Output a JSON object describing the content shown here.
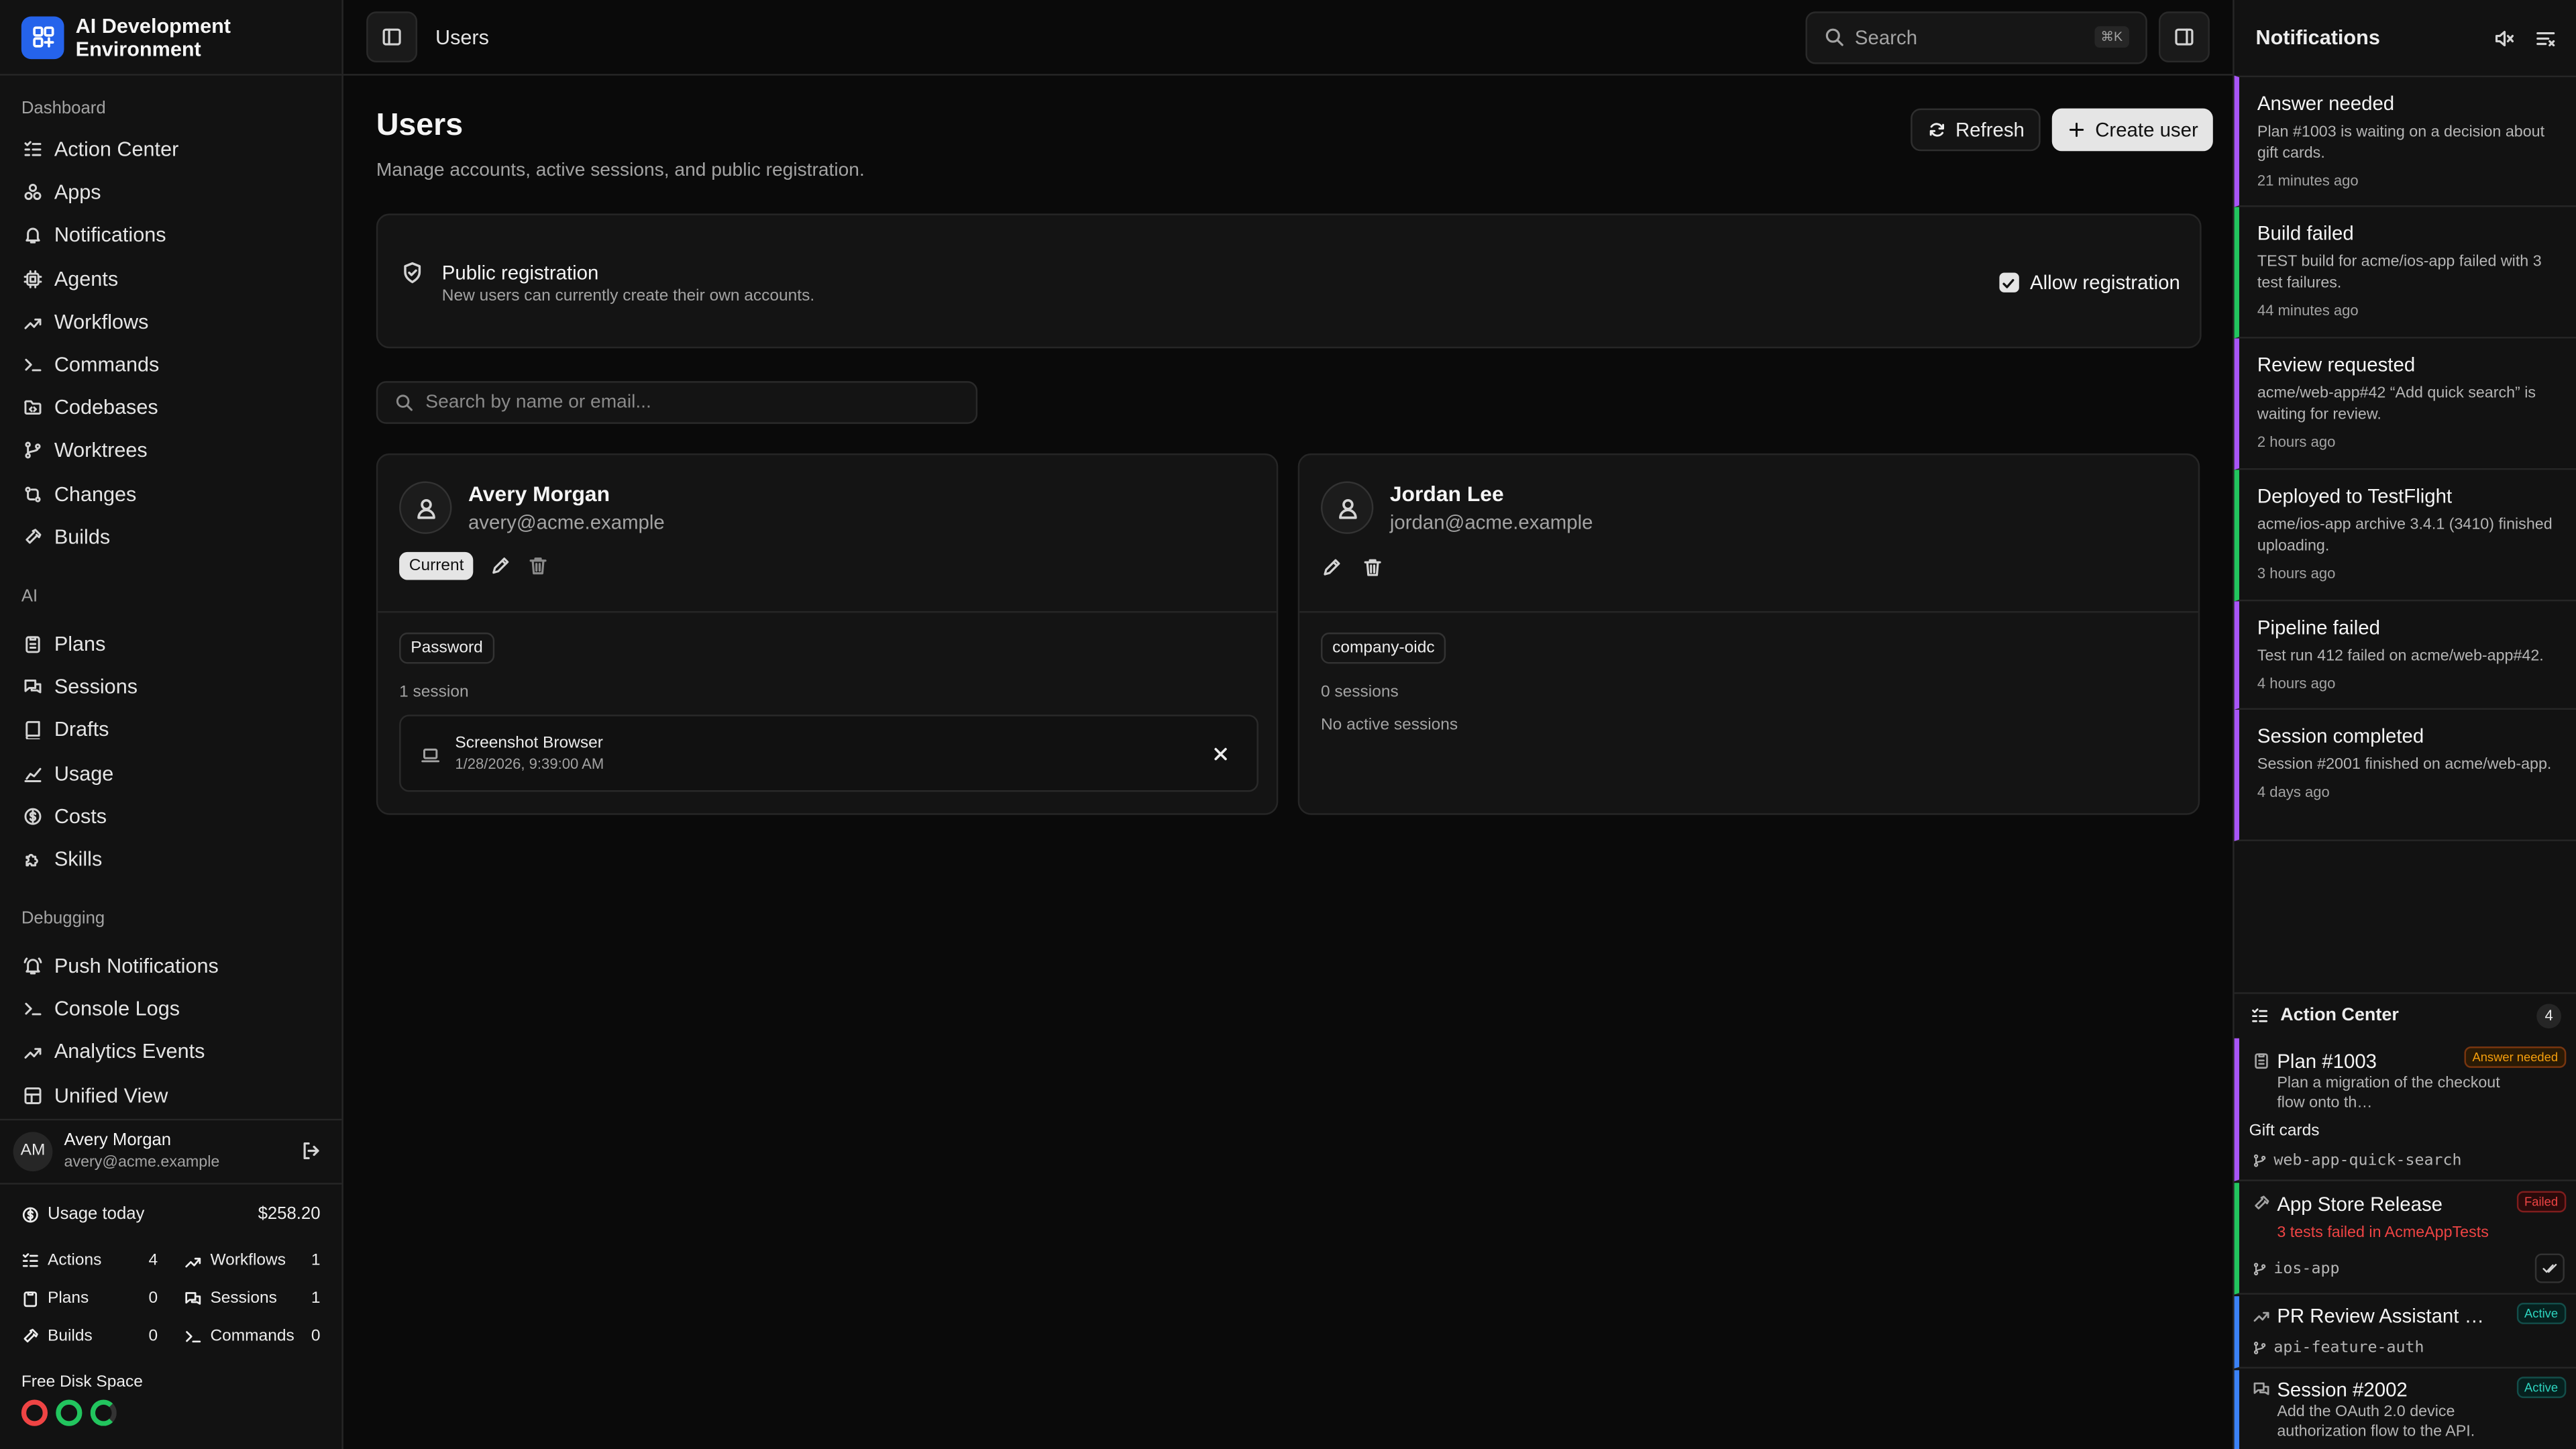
{
  "app": {
    "title": "AI Development Environment"
  },
  "sidebar": {
    "sections": {
      "dashboard": "Dashboard",
      "ai": "AI",
      "debugging": "Debugging"
    },
    "dashboard_items": [
      {
        "label": "Action Center",
        "icon": "list-check-icon"
      },
      {
        "label": "Apps",
        "icon": "apps-icon"
      },
      {
        "label": "Notifications",
        "icon": "bell-icon"
      },
      {
        "label": "Agents",
        "icon": "cpu-icon"
      },
      {
        "label": "Workflows",
        "icon": "workflow-icon"
      },
      {
        "label": "Commands",
        "icon": "terminal-icon"
      },
      {
        "label": "Codebases",
        "icon": "folder-code-icon"
      },
      {
        "label": "Worktrees",
        "icon": "git-branch-icon"
      },
      {
        "label": "Changes",
        "icon": "git-compare-icon"
      },
      {
        "label": "Builds",
        "icon": "hammer-icon"
      }
    ],
    "ai_items": [
      {
        "label": "Plans",
        "icon": "clipboard-icon"
      },
      {
        "label": "Sessions",
        "icon": "messages-icon"
      },
      {
        "label": "Drafts",
        "icon": "book-icon"
      },
      {
        "label": "Usage",
        "icon": "chart-icon"
      },
      {
        "label": "Costs",
        "icon": "dollar-icon"
      },
      {
        "label": "Skills",
        "icon": "puzzle-icon"
      }
    ],
    "debugging_items": [
      {
        "label": "Push Notifications",
        "icon": "bell-ring-icon"
      },
      {
        "label": "Console Logs",
        "icon": "terminal-icon"
      },
      {
        "label": "Analytics Events",
        "icon": "workflow-icon"
      },
      {
        "label": "Unified View",
        "icon": "layout-icon"
      }
    ],
    "user": {
      "initials": "AM",
      "name": "Avery Morgan",
      "email": "avery@acme.example"
    },
    "usage": {
      "label": "Usage today",
      "value": "$258.20",
      "stats": [
        {
          "label": "Actions",
          "value": "4"
        },
        {
          "label": "Workflows",
          "value": "1"
        },
        {
          "label": "Plans",
          "value": "0"
        },
        {
          "label": "Sessions",
          "value": "1"
        },
        {
          "label": "Builds",
          "value": "0"
        },
        {
          "label": "Commands",
          "value": "0"
        }
      ]
    },
    "disk": {
      "label": "Free Disk Space",
      "ring_colors": [
        "#ef4444",
        "#22c55e",
        "#22c55e"
      ]
    }
  },
  "topbar": {
    "breadcrumb": "Users",
    "search_placeholder": "Search",
    "search_shortcut": "⌘K"
  },
  "page": {
    "title": "Users",
    "subtitle": "Manage accounts, active sessions, and public registration.",
    "refresh_label": "Refresh",
    "create_label": "Create user",
    "registration": {
      "title": "Public registration",
      "description": "New users can currently create their own accounts.",
      "checkbox_label": "Allow registration",
      "checked": true
    },
    "user_search_placeholder": "Search by name or email...",
    "users": [
      {
        "name": "Avery Morgan",
        "email": "avery@acme.example",
        "current_label": "Current",
        "auth": "Password",
        "session_count": "1 session",
        "session": {
          "name": "Screenshot Browser",
          "time": "1/28/2026, 9:39:00 AM"
        }
      },
      {
        "name": "Jordan Lee",
        "email": "jordan@acme.example",
        "auth": "company-oidc",
        "session_count": "0 sessions",
        "empty": "No active sessions"
      }
    ]
  },
  "notifications": {
    "title": "Notifications",
    "items": [
      {
        "title": "Answer needed",
        "desc": "Plan #1003 is waiting on a decision about gift cards.",
        "time": "21 minutes ago",
        "color": "#a855f7"
      },
      {
        "title": "Build failed",
        "desc": "TEST build for acme/ios-app failed with 3 test failures.",
        "time": "44 minutes ago",
        "color": "#22c55e"
      },
      {
        "title": "Review requested",
        "desc": "acme/web-app#42 “Add quick search” is waiting for review.",
        "time": "2 hours ago",
        "color": "#a855f7"
      },
      {
        "title": "Deployed to TestFlight",
        "desc": "acme/ios-app archive 3.4.1 (3410) finished uploading.",
        "time": "3 hours ago",
        "color": "#22c55e"
      },
      {
        "title": "Pipeline failed",
        "desc": "Test run 412 failed on acme/web-app#42.",
        "time": "4 hours ago",
        "color": "#a855f7"
      },
      {
        "title": "Session completed",
        "desc": "Session #2001 finished on acme/web-app.",
        "time": "4 days ago",
        "color": "#a855f7"
      }
    ],
    "action_center": {
      "title": "Action Center",
      "count": "4",
      "items": [
        {
          "title": "Plan #1003",
          "badge": "Answer needed",
          "desc": "Plan a migration of the checkout flow onto th…",
          "extra": "Gift cards",
          "branch": "web-app-quick-search"
        },
        {
          "title": "App Store Release",
          "badge": "Failed",
          "desc": "3 tests failed in AcmeAppTests",
          "branch": "ios-app"
        },
        {
          "title": "PR Review Assistant #4…",
          "badge": "Active",
          "branch": "api-feature-auth"
        },
        {
          "title": "Session #2002",
          "badge": "Active",
          "desc": "Add the OAuth 2.0 device authorization flow to the API."
        }
      ]
    }
  }
}
